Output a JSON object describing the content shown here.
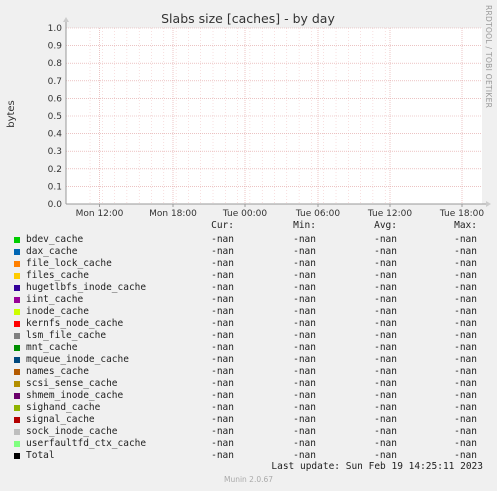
{
  "chart_data": {
    "type": "line",
    "title": "Slabs size [caches] - by day",
    "ylabel": "bytes",
    "xlabel": "",
    "ylim": [
      0,
      1
    ],
    "yticks": [
      "0.0",
      "0.1",
      "0.2",
      "0.3",
      "0.4",
      "0.5",
      "0.6",
      "0.7",
      "0.8",
      "0.9",
      "1.0"
    ],
    "xticks": [
      "Mon 12:00",
      "Mon 18:00",
      "Tue 00:00",
      "Tue 06:00",
      "Tue 12:00",
      "Tue 18:00"
    ],
    "grid": true,
    "series": []
  },
  "side_text": "RRDTOOL / TOBI OETIKER",
  "legend": {
    "headers": [
      "Cur:",
      "Min:",
      "Avg:",
      "Max:"
    ],
    "rows": [
      {
        "name": "bdev_cache",
        "color": "#00cc00",
        "cur": "-nan",
        "min": "-nan",
        "avg": "-nan",
        "max": "-nan"
      },
      {
        "name": "dax_cache",
        "color": "#0066b3",
        "cur": "-nan",
        "min": "-nan",
        "avg": "-nan",
        "max": "-nan"
      },
      {
        "name": "file_lock_cache",
        "color": "#ff8000",
        "cur": "-nan",
        "min": "-nan",
        "avg": "-nan",
        "max": "-nan"
      },
      {
        "name": "files_cache",
        "color": "#ffcc00",
        "cur": "-nan",
        "min": "-nan",
        "avg": "-nan",
        "max": "-nan"
      },
      {
        "name": "hugetlbfs_inode_cache",
        "color": "#330099",
        "cur": "-nan",
        "min": "-nan",
        "avg": "-nan",
        "max": "-nan"
      },
      {
        "name": "iint_cache",
        "color": "#990099",
        "cur": "-nan",
        "min": "-nan",
        "avg": "-nan",
        "max": "-nan"
      },
      {
        "name": "inode_cache",
        "color": "#ccff00",
        "cur": "-nan",
        "min": "-nan",
        "avg": "-nan",
        "max": "-nan"
      },
      {
        "name": "kernfs_node_cache",
        "color": "#ff0000",
        "cur": "-nan",
        "min": "-nan",
        "avg": "-nan",
        "max": "-nan"
      },
      {
        "name": "lsm_file_cache",
        "color": "#808080",
        "cur": "-nan",
        "min": "-nan",
        "avg": "-nan",
        "max": "-nan"
      },
      {
        "name": "mnt_cache",
        "color": "#008f00",
        "cur": "-nan",
        "min": "-nan",
        "avg": "-nan",
        "max": "-nan"
      },
      {
        "name": "mqueue_inode_cache",
        "color": "#00487d",
        "cur": "-nan",
        "min": "-nan",
        "avg": "-nan",
        "max": "-nan"
      },
      {
        "name": "names_cache",
        "color": "#b35a00",
        "cur": "-nan",
        "min": "-nan",
        "avg": "-nan",
        "max": "-nan"
      },
      {
        "name": "scsi_sense_cache",
        "color": "#b38f00",
        "cur": "-nan",
        "min": "-nan",
        "avg": "-nan",
        "max": "-nan"
      },
      {
        "name": "shmem_inode_cache",
        "color": "#6b006b",
        "cur": "-nan",
        "min": "-nan",
        "avg": "-nan",
        "max": "-nan"
      },
      {
        "name": "sighand_cache",
        "color": "#8fb300",
        "cur": "-nan",
        "min": "-nan",
        "avg": "-nan",
        "max": "-nan"
      },
      {
        "name": "signal_cache",
        "color": "#b30000",
        "cur": "-nan",
        "min": "-nan",
        "avg": "-nan",
        "max": "-nan"
      },
      {
        "name": "sock_inode_cache",
        "color": "#bebebe",
        "cur": "-nan",
        "min": "-nan",
        "avg": "-nan",
        "max": "-nan"
      },
      {
        "name": "userfaultfd_ctx_cache",
        "color": "#80ff80",
        "cur": "-nan",
        "min": "-nan",
        "avg": "-nan",
        "max": "-nan"
      },
      {
        "name": "Total",
        "color": "#000000",
        "cur": "-nan",
        "min": "-nan",
        "avg": "-nan",
        "max": "-nan"
      }
    ]
  },
  "last_update": "Last update: Sun Feb 19 14:25:11 2023",
  "footer": "Munin 2.0.67"
}
